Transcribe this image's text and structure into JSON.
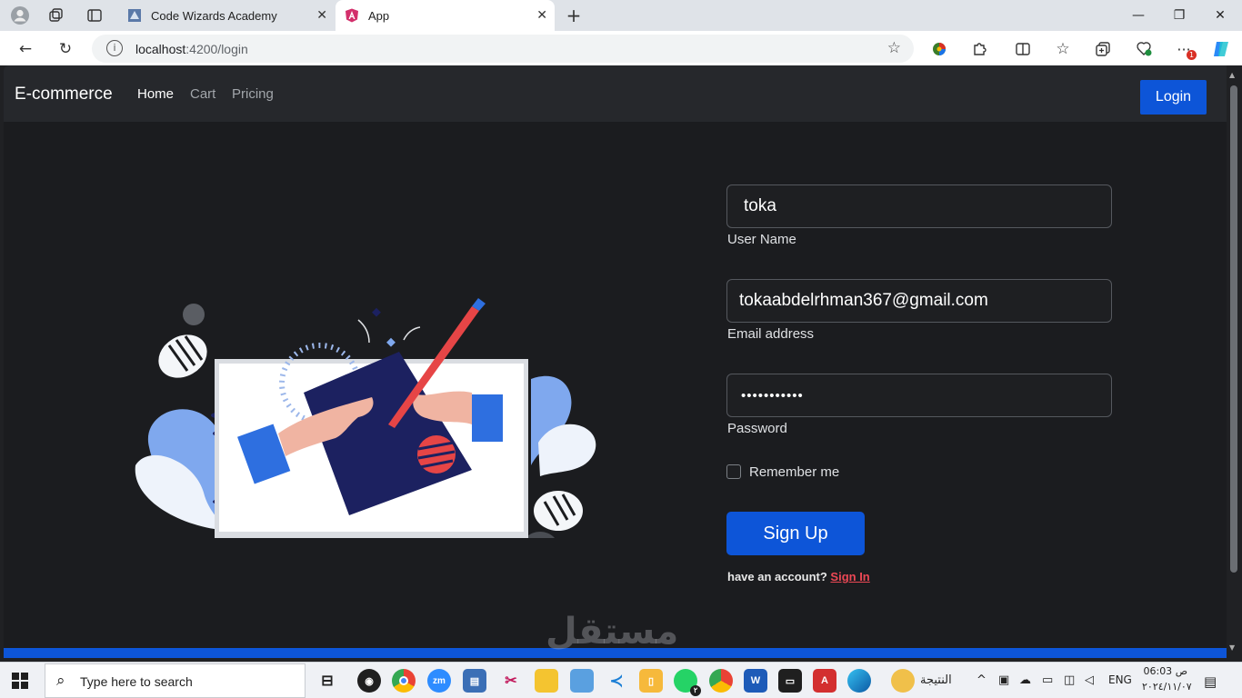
{
  "browser": {
    "tabs": [
      {
        "title": "Code Wizards Academy",
        "active": false
      },
      {
        "title": "App",
        "active": true
      }
    ],
    "new_tab_icon": "plus-icon",
    "url_host": "localhost",
    "url_rest": ":4200/login",
    "window_controls": {
      "minimize": "—",
      "maximize": "❐",
      "close": "✕"
    }
  },
  "navbar": {
    "brand": "E-commerce",
    "links": [
      "Home",
      "Cart",
      "Pricing"
    ],
    "login_label": "Login"
  },
  "form": {
    "username_value": "toka",
    "username_label": "User Name",
    "email_value": "tokaabdelrhman367@gmail.com",
    "email_label": "Email address",
    "password_value": "•••••••••••",
    "password_label": "Password",
    "remember_label": "Remember me",
    "signup_label": "Sign Up",
    "account_prompt": "have an account? ",
    "signin_label": "Sign In"
  },
  "watermark": "مستقل",
  "taskbar": {
    "search_placeholder": "Type here to search",
    "weather_text": "النتيجة",
    "language": "ENG",
    "time": "06:03 ص",
    "date": "٢٠٢٤/١١/٠٧",
    "whatsapp_badge": "٢"
  },
  "colors": {
    "accent": "#0d55d8",
    "signin": "#ec4855",
    "page_bg": "#1b1c1f",
    "navbar_bg": "#26282c"
  }
}
